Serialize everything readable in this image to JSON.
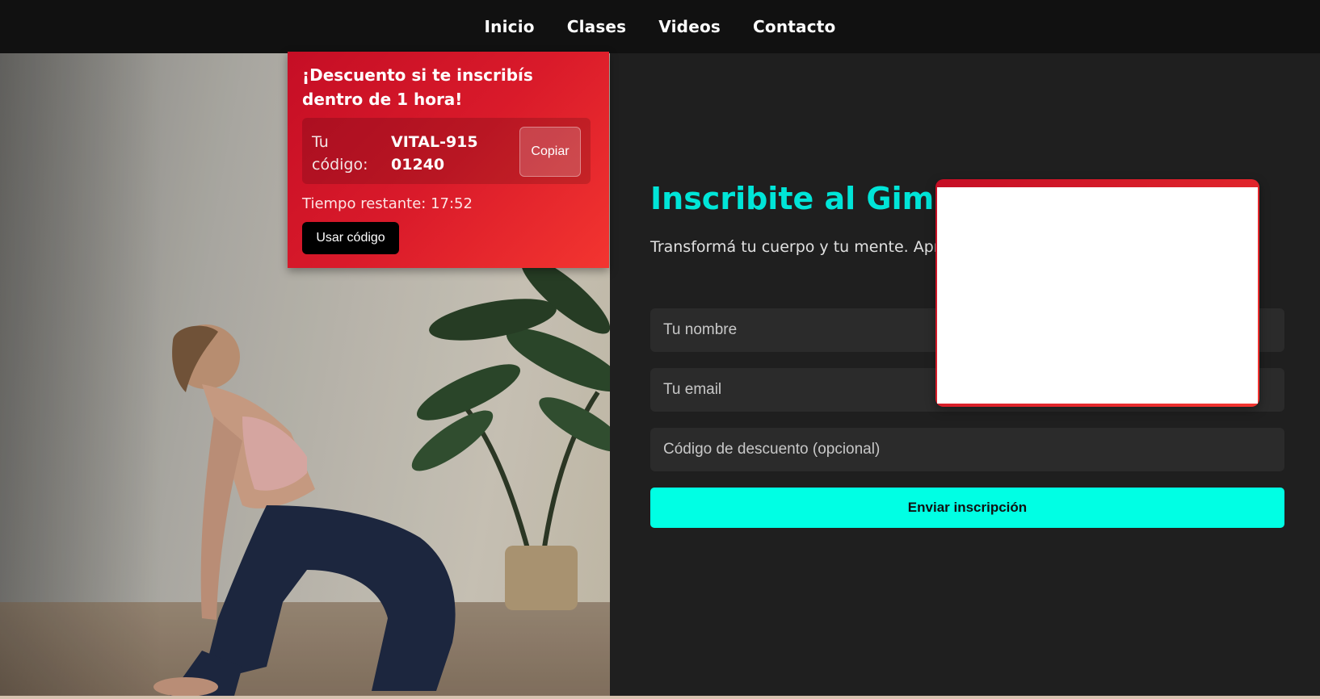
{
  "nav": {
    "items": [
      "Inicio",
      "Clases",
      "Videos",
      "Contacto"
    ]
  },
  "promo": {
    "title": "¡Descuento si te inscribís dentro de 1 hora!",
    "code_label": "Tu código:",
    "code_value": "VITAL-91501240",
    "copy_label": "Copiar",
    "timer_text": "Tiempo restante: 17:52",
    "use_label": "Usar código"
  },
  "signup": {
    "title": "Inscribite al Gimna",
    "subtitle": "Transformá tu cuerpo y tu mente. Aprove próxima hora.",
    "name_placeholder": "Tu nombre",
    "email_placeholder": "Tu email",
    "code_placeholder": "Código de descuento (opcional)",
    "submit_label": "Enviar inscripción"
  },
  "colors": {
    "accent": "#00ffe4",
    "promo_red": "#d91a2a",
    "bg": "#1f1f1f"
  }
}
